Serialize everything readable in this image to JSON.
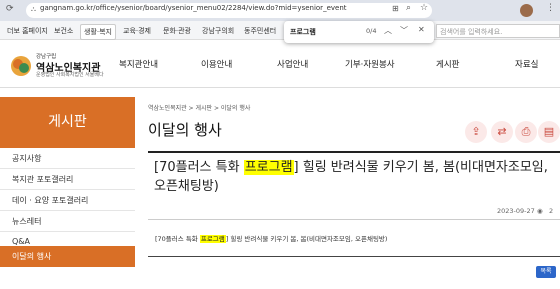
{
  "browser": {
    "url": "gangnam.go.kr/office/ysenior/board/ysenior_menu02/2284/view.do?mid=ysenior_event",
    "tabs": [
      "더보 홈페이지",
      "보건소",
      "생활·복지",
      "교육·경제",
      "문화·관광",
      "강남구의회",
      "동주민센터"
    ],
    "active_tab": 2
  },
  "find": {
    "query": "프로그램",
    "count": "0/4"
  },
  "site_search": {
    "placeholder": "검색어를 입력하세요."
  },
  "logo": {
    "small": "강남구립",
    "main": "역삼노인복지관",
    "sub": "운영법인 사회복지법인 서울베다"
  },
  "gnb": [
    "복지관안내",
    "이용안내",
    "사업안내",
    "기부·자원봉사",
    "게시판",
    "자료실"
  ],
  "sidebar": {
    "title": "게시판",
    "items": [
      "공지사항",
      "복지관 포토갤러리",
      "데이 · 요양 포토갤러리",
      "뉴스레터",
      "Q&A",
      "이달의 행사"
    ],
    "active_index": 5
  },
  "breadcrumb": "역삼노인복지관 > 게시판 > 이달의 행사",
  "page_title": "이달의 행사",
  "post": {
    "title_pre": "[70플러스 특화 ",
    "title_highlight": "프로그램",
    "title_post": "] 힐링 반려식물 키우기 봄, 봄(비대면자조모임, 오픈채팅방)",
    "date": "2023-09-27",
    "views": "2",
    "body_pre": "[70플러스 특화 ",
    "body_highlight": "프로그램",
    "body_post": "] 힐링 반려식물 키우기 봄, 봄(비대면자조모임, 오픈채팅방)"
  },
  "list_button": "목록",
  "colors": {
    "accent": "#d96f26",
    "highlight": "#ffff00",
    "button": "#2c66c9"
  }
}
